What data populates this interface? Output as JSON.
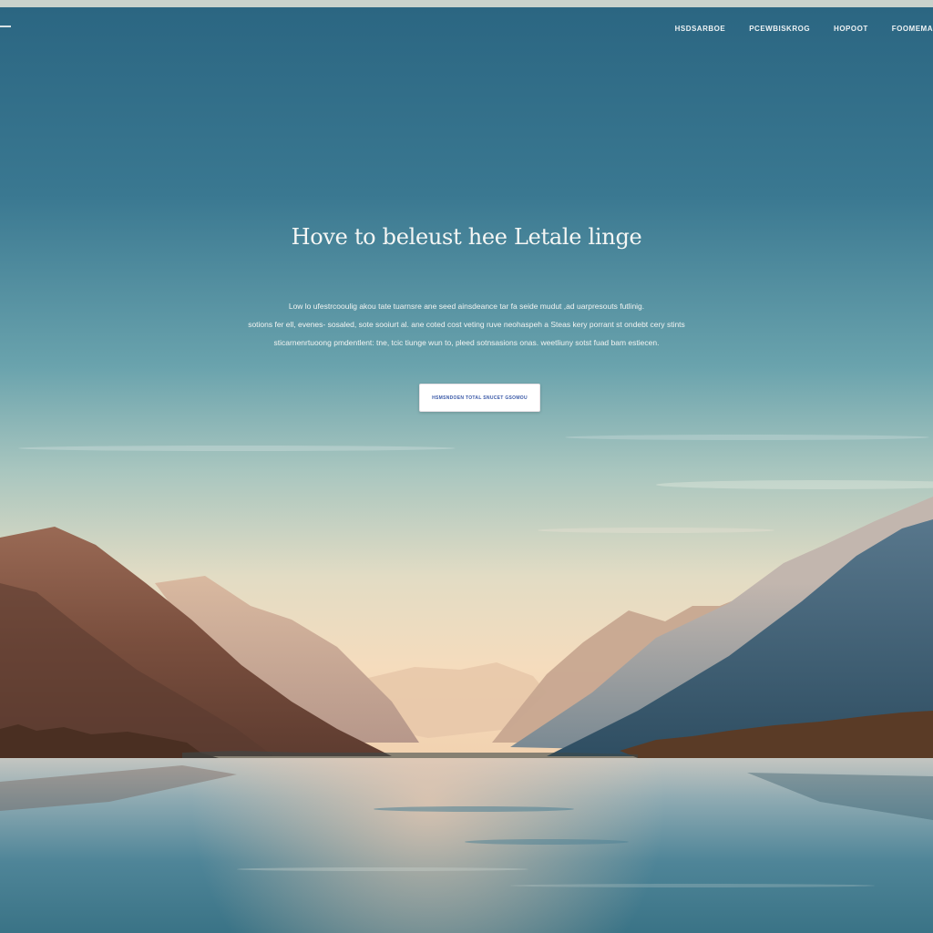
{
  "nav": {
    "items": [
      {
        "label": "HSDSARBOE"
      },
      {
        "label": "PCEWBISKROG"
      },
      {
        "label": "HOPOOT"
      },
      {
        "label": "FOOMEMA"
      }
    ]
  },
  "hero": {
    "title": "Hove to beleust hee Letale linge",
    "description_lines": [
      "Low lo ufestrcooulig akou tate tuarnsre ane seed ainsdeance tar fa seide mudut ,ad uarpresouts futlinig.",
      "sotions fer ell, evenes- sosaled, sote sooiurt al. ane coted cost veting ruve neohaspeh a Steas kery porrant st ondebt cery stints",
      "sticarnenrtuoong pmdentlent: tne, tcic tiunge wun to, pleed sotnsasions onas. weetliuny sotst fuad bam estiecen."
    ],
    "button_label": "HSMSNDOEN TOTAL SNUCET GSOMOU"
  },
  "colors": {
    "sky_top": "#2b6783",
    "sky_mid": "#5e9aa8",
    "horizon": "#f3dcc0",
    "water": "#3f7a90",
    "button_text": "#3b5aa8"
  }
}
